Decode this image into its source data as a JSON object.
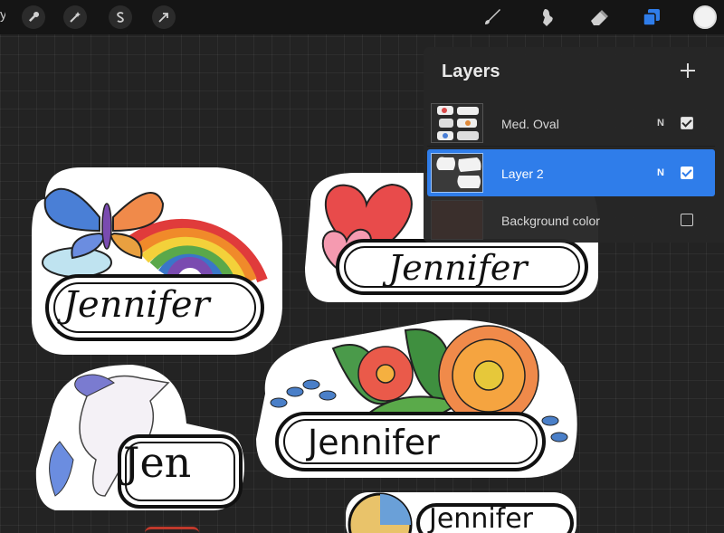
{
  "toolbar": {
    "gallery_label": "y",
    "left_tools": [
      {
        "name": "actions",
        "icon": "wrench-icon"
      },
      {
        "name": "adjustments",
        "icon": "magic-wand-icon"
      },
      {
        "name": "selection",
        "icon": "selection-s-icon"
      },
      {
        "name": "transform",
        "icon": "arrow-cursor-icon"
      }
    ],
    "right_tools": [
      {
        "name": "brush",
        "icon": "brush-icon"
      },
      {
        "name": "smudge",
        "icon": "smudge-icon"
      },
      {
        "name": "eraser",
        "icon": "eraser-icon"
      },
      {
        "name": "layers",
        "icon": "layers-icon",
        "active": true
      }
    ],
    "accent_color": "#2f7dea",
    "current_color": "#f2f2f2"
  },
  "layers_panel": {
    "title": "Layers",
    "add_icon": "plus-icon",
    "layers": [
      {
        "name": "Med. Oval",
        "blend": "N",
        "visible": true,
        "active": false
      },
      {
        "name": "Layer 2",
        "blend": "N",
        "visible": true,
        "active": true
      },
      {
        "name": "Background color",
        "blend": "",
        "visible": false,
        "active": false
      }
    ]
  },
  "canvas": {
    "stickers": [
      {
        "id": "rainbow",
        "text": "Jennifer"
      },
      {
        "id": "hearts",
        "text": "Jennifer"
      },
      {
        "id": "flowers",
        "text": "Jennifer"
      },
      {
        "id": "unicorn",
        "text": "Jen"
      },
      {
        "id": "globe",
        "text": "Jennifer"
      }
    ]
  }
}
